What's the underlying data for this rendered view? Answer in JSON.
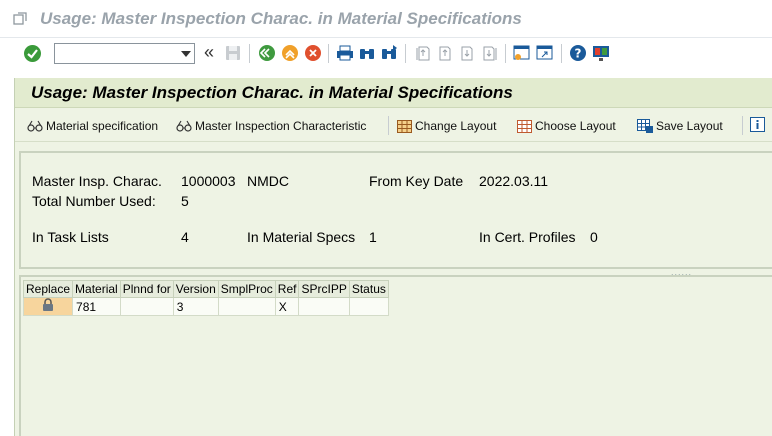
{
  "window": {
    "title": "Usage: Master Inspection Charac. in Material Specifications"
  },
  "toolbar": {
    "command_value": "",
    "command_placeholder": "",
    "back_chevron": "«",
    "icons": [
      "enter-icon",
      "save-icon",
      "back-icon",
      "exit-icon",
      "cancel-icon",
      "print-icon",
      "find-icon",
      "find-next-icon",
      "first-page-icon",
      "previous-page-icon",
      "next-page-icon",
      "last-page-icon",
      "create-session-icon",
      "shortcut-icon",
      "help-icon",
      "customize-layout-icon"
    ]
  },
  "screen": {
    "title": "Usage: Master Inspection Charac. in Material Specifications",
    "app_buttons": {
      "material_spec": "Material specification",
      "mic": "Master Inspection Characteristic",
      "change_layout": "Change Layout",
      "choose_layout": "Choose Layout",
      "save_layout": "Save Layout"
    }
  },
  "info": {
    "mic_label": "Master Insp. Charac.",
    "mic_value": "1000003",
    "mic_plant": "NMDC",
    "key_date_label": "From Key Date",
    "key_date_value": "2022.03.11",
    "total_label": "Total Number Used:",
    "total_value": "5",
    "task_lists_label": "In Task Lists",
    "task_lists_value": "4",
    "mat_specs_label": "In Material Specs",
    "mat_specs_value": "1",
    "cert_label": "In Cert. Profiles",
    "cert_value": "0"
  },
  "grid": {
    "resize_handle": "......",
    "columns": [
      "Replace",
      "Material",
      "Plnnd for",
      "Version",
      "SmplProc",
      "Ref",
      "SPrcIPP",
      "Status"
    ],
    "rows": [
      {
        "replace": "",
        "material": "781",
        "planned": "",
        "version": "3",
        "smplproc": "",
        "ref": "X",
        "sprcipp": "",
        "status": ""
      }
    ]
  },
  "colors": {
    "screen_bg": "#eef3e4",
    "header_bg": "#e2ebcf",
    "ok_green": "#3a9a3a",
    "lock_cell": "#f7d59d"
  }
}
